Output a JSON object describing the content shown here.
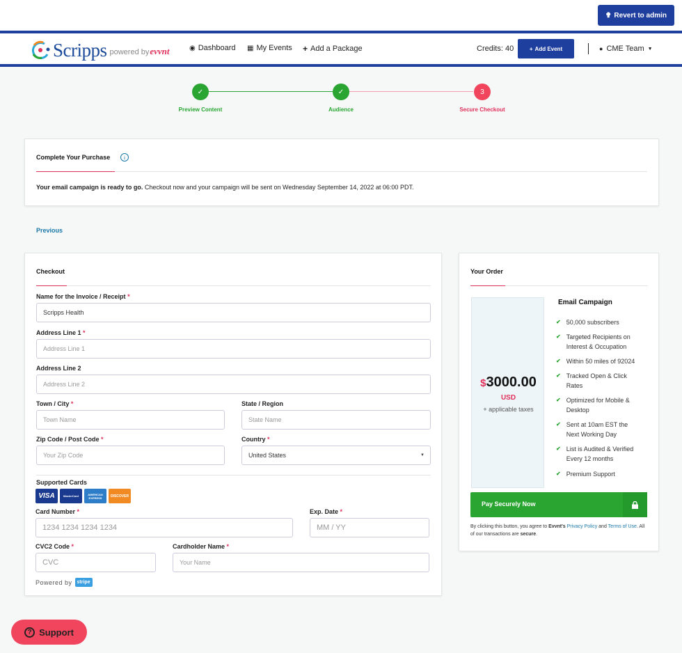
{
  "top": {
    "revert_label": "Revert to admin"
  },
  "nav": {
    "brand": "Scripps",
    "powered_by": "powered by",
    "powered_brand": "evvnt",
    "links": [
      "Dashboard",
      "My Events",
      "Add a Package"
    ],
    "credits": "Credits: 40",
    "add_event": "Add Event",
    "user": "CME Team"
  },
  "steps": [
    {
      "label": "Preview Content",
      "mark": "✓",
      "state": "done"
    },
    {
      "label": "Audience",
      "mark": "✓",
      "state": "done"
    },
    {
      "label": "Secure Checkout",
      "mark": "3",
      "state": "current"
    }
  ],
  "purchase": {
    "title": "Complete Your Purchase",
    "ready_bold": "Your email campaign is ready to go.",
    "ready_text": " Checkout now and your campaign will be sent on Wednesday September 14, 2022 at 06:00 PDT."
  },
  "previous": "Previous",
  "checkout": {
    "title": "Checkout",
    "fields": {
      "invoice_name": {
        "label": "Name for the Invoice / Receipt",
        "value": "Scripps Health"
      },
      "address1": {
        "label": "Address Line 1",
        "placeholder": "Address Line 1"
      },
      "address2": {
        "label": "Address Line 2",
        "placeholder": "Address Line 2"
      },
      "town": {
        "label": "Town / City",
        "placeholder": "Town Name"
      },
      "state": {
        "label": "State / Region",
        "placeholder": "State Name"
      },
      "zip": {
        "label": "Zip Code / Post Code",
        "placeholder": "Your Zip Code"
      },
      "country": {
        "label": "Country",
        "value": "United States"
      },
      "card_number": {
        "label": "Card Number",
        "placeholder": "1234 1234 1234 1234"
      },
      "exp": {
        "label": "Exp. Date",
        "placeholder": "MM / YY"
      },
      "cvc": {
        "label": "CVC2 Code",
        "placeholder": "CVC"
      },
      "holder": {
        "label": "Cardholder Name",
        "placeholder": "Your Name"
      }
    },
    "supported_cards": "Supported Cards",
    "card_brands": [
      "VISA",
      "MasterCard",
      "AMERICAN EXPRESS",
      "DISCOVER"
    ],
    "powered_by": "Powered by",
    "stripe": "stripe"
  },
  "order": {
    "title": "Your Order",
    "product": "Email Campaign",
    "currency_symbol": "$",
    "price": "3000.00",
    "currency": "USD",
    "taxes": "+ applicable taxes",
    "features": [
      [
        "50,000 subscribers"
      ],
      [
        "Targeted Recipients on",
        "Interest & Occupation"
      ],
      [
        "Within 50 miles of 92024"
      ],
      [
        "Tracked Open & Click",
        "Rates"
      ],
      [
        "Optimized for Mobile &",
        "Desktop"
      ],
      [
        "Sent at 10am EST the",
        "Next Working Day"
      ],
      [
        "List is Audited & Verified",
        "Every 12 months"
      ],
      [
        "Premium Support"
      ]
    ],
    "pay_label": "Pay Securely Now",
    "terms": {
      "t1": "By clicking this button, you agree to ",
      "brand": "Evvnt's",
      "t2": " ",
      "privacy": "Privacy Policy",
      "t3": " and ",
      "terms_link": "Terms of Use",
      "t4": ". All of our transactions are ",
      "secure": "secure",
      "t5": "."
    }
  },
  "support": "Support",
  "colors": {
    "primary": "#1f3f9e",
    "success": "#2aa532",
    "danger": "#e0305a",
    "link": "#1a78a8"
  }
}
